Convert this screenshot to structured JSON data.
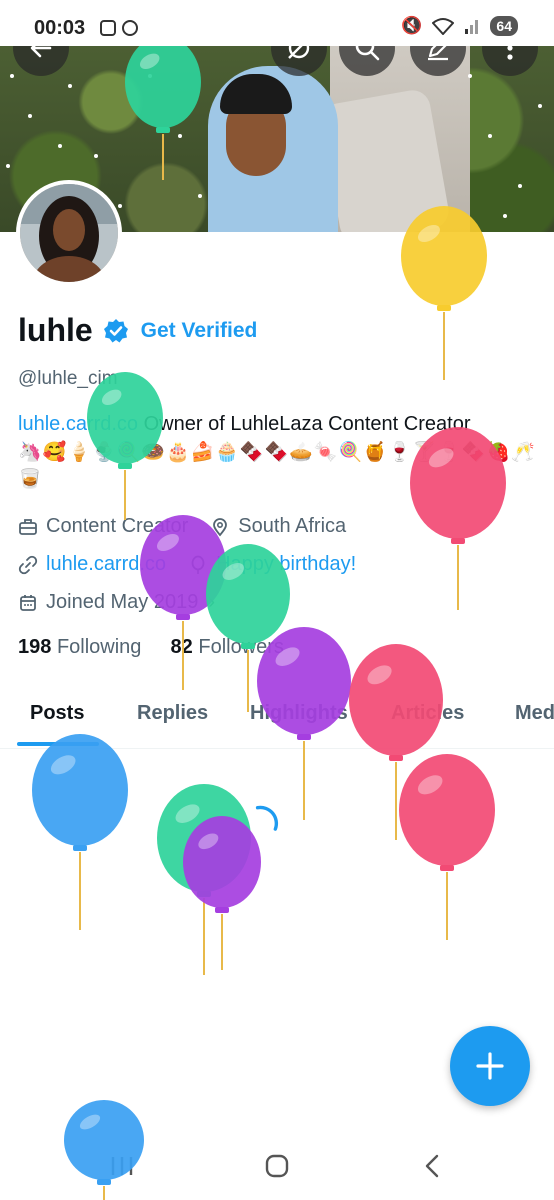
{
  "status_bar": {
    "time": "00:03",
    "battery": "64"
  },
  "profile": {
    "display_name": "luhle",
    "get_verified": "Get Verified",
    "handle": "@luhle_cim",
    "bio_link": "luhle.carrd.co",
    "bio_text": " Owner of LuhleLaza Content Creator",
    "bio_emojis": "🦄🥰🍦🍨🍭🍩🎂🍰🧁🍫🍫🥧🍬🍭🍯🍷🍸🍷🍫🍓🥂",
    "bio_emojis_2": "🥃",
    "category": "Content Creator",
    "location": "South Africa",
    "website": "luhle.carrd.co",
    "birthday": "Happy birthday!",
    "joined": "Joined May 2019",
    "following_count": "198",
    "following_label": "Following",
    "followers_count": "82",
    "followers_label": "Followers"
  },
  "tabs": [
    {
      "label": "Posts",
      "active": true
    },
    {
      "label": "Replies"
    },
    {
      "label": "Highlights"
    },
    {
      "label": "Articles"
    },
    {
      "label": "Media"
    }
  ],
  "fab": {
    "icon": "plus-icon"
  },
  "colors": {
    "accent": "#1d9bf0",
    "text": "#0f1419",
    "muted": "#536471"
  },
  "balloons": [
    {
      "color": "#2ed39a"
    },
    {
      "color": "#f7cc2e"
    },
    {
      "color": "#2ed39a"
    },
    {
      "color": "#f24a74"
    },
    {
      "color": "#a53ee0"
    },
    {
      "color": "#2ed39a"
    },
    {
      "color": "#a53ee0"
    },
    {
      "color": "#f24a74"
    },
    {
      "color": "#3aa0f2"
    },
    {
      "color": "#f24a74"
    },
    {
      "color": "#2ed39a"
    },
    {
      "color": "#a53ee0"
    },
    {
      "color": "#3aa0f2"
    }
  ]
}
